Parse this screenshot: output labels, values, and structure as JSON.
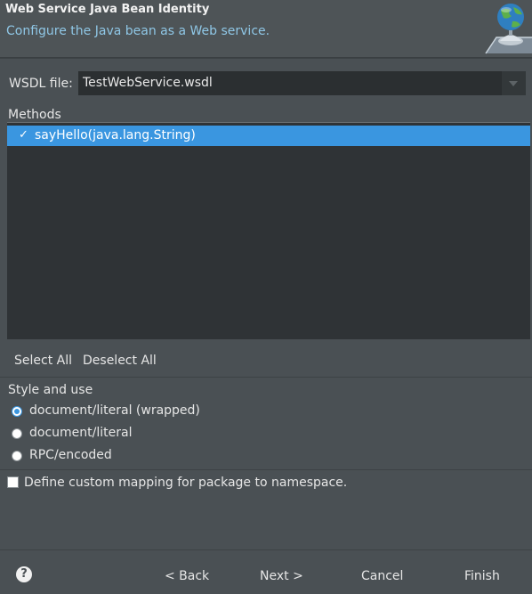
{
  "header": {
    "title": "Web Service Java Bean Identity",
    "subtitle": "Configure the Java bean as a Web service.",
    "icon": "globe-service-icon"
  },
  "wsdl": {
    "label": "WSDL file:",
    "value": "TestWebService.wsdl"
  },
  "methods": {
    "label": "Methods",
    "items": [
      {
        "label": "sayHello(java.lang.String)",
        "checked": true,
        "selected": true
      }
    ],
    "select_all": "Select All",
    "deselect_all": "Deselect All"
  },
  "style_use": {
    "label": "Style and use",
    "options": [
      {
        "label": "document/literal (wrapped)",
        "checked": true
      },
      {
        "label": "document/literal",
        "checked": false
      },
      {
        "label": "RPC/encoded",
        "checked": false
      }
    ]
  },
  "custom_mapping": {
    "label": "Define custom mapping for package to namespace.",
    "checked": false
  },
  "footer": {
    "help": "?",
    "back": "< Back",
    "next": "Next >",
    "cancel": "Cancel",
    "finish": "Finish"
  },
  "colors": {
    "background": "#4a5054",
    "selection": "#3a96e0",
    "subtitle": "#8fc7e6",
    "list_background": "#2f3336"
  }
}
